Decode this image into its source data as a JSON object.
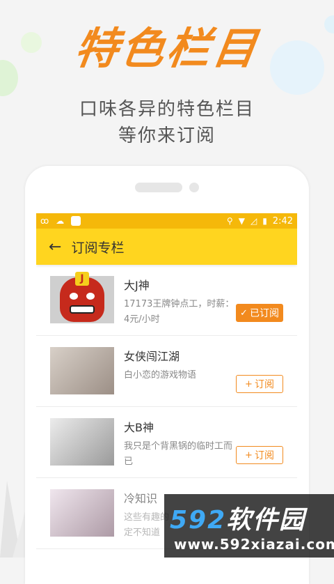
{
  "hero": {
    "title": "特色栏目",
    "subtitle_line1": "口味各异的特色栏目",
    "subtitle_line2": "等你来订阅"
  },
  "status_bar": {
    "time": "2:42",
    "left_icons": [
      "notification-icon",
      "cloud-icon",
      "app-icon"
    ],
    "right_icons": [
      "location-icon",
      "wifi-icon",
      "no-signal-icon",
      "battery-icon"
    ]
  },
  "app_bar": {
    "title": "订阅专栏",
    "back_icon": "arrow-left-icon"
  },
  "items": [
    {
      "name": "大J神",
      "desc": "17173王牌钟点工，时薪：4元/小时",
      "button": "已订阅",
      "subscribed": true
    },
    {
      "name": "女侠闯江湖",
      "desc": "白小恋的游戏物语",
      "button": "订阅",
      "subscribed": false
    },
    {
      "name": "大B神",
      "desc": "我只是个背黑锅的临时工而已",
      "button": "订阅",
      "subscribed": false
    },
    {
      "name": "冷知识",
      "desc": "这些有趣的",
      "desc2": "定不知道",
      "subscribed": false
    }
  ],
  "watermark": {
    "digits": "592",
    "cn": "软件园",
    "url": "www.592xiazai.com"
  },
  "colors": {
    "accent_orange": "#f28a1e",
    "app_bar_yellow": "#ffd51f",
    "status_bar_yellow": "#f5b80a"
  }
}
